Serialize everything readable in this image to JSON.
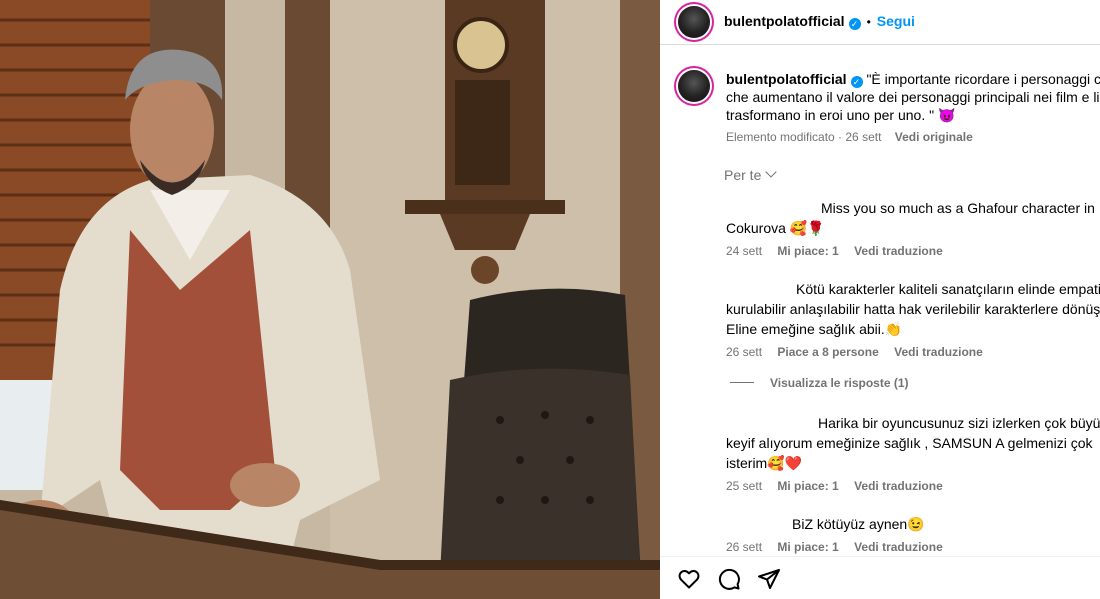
{
  "post": {
    "author": "bulentpolatofficial",
    "verified_icon": "verified-badge-icon",
    "follow_label": "Segui",
    "separator": "•"
  },
  "caption": {
    "author": "bulentpolatofficial",
    "text_line1": "\"È importante ricordare i personaggi ca",
    "text_line2": "che aumentano il valore dei personaggi principali nei film e li",
    "text_line3": "trasformano in eroi uno per uno. \" 😈",
    "edited": "Elemento modificato · 26 sett",
    "see_original": "Vedi originale"
  },
  "filter": {
    "label": "Per te",
    "icon": "chevron-down-icon"
  },
  "comments": [
    {
      "lines": [
        "Miss you so much as a Ghafour character in",
        "Cokurova 🥰🌹"
      ],
      "time": "24 sett",
      "likes": "Mi piace: 1",
      "translate": "Vedi traduzione"
    },
    {
      "lines": [
        "Kötü karakterler kaliteli sanatçıların elinde empati",
        "kurulabilir anlaşılabilir hatta hak verilebilir karakterlere dönüşü",
        "Eline emeğine sağlık abii.👏"
      ],
      "time": "26 sett",
      "likes": "Piace a 8 persone",
      "translate": "Vedi traduzione"
    },
    {
      "lines": [
        "Harika bir oyuncusunuz sizi izlerken çok büyük",
        "keyif alıyorum emeğinize sağlık , SAMSUN A gelmenizi çok",
        "isterim🥰❤️"
      ],
      "time": "25 sett",
      "likes": "Mi piace: 1",
      "translate": "Vedi traduzione"
    },
    {
      "lines": [
        "BiZ kötüyüz aynen😉"
      ],
      "time": "26 sett",
      "likes": "Mi piace: 1",
      "translate": "Vedi traduzione"
    }
  ],
  "view_replies": "Visualizza le risposte (1)",
  "actions": [
    "heart-icon",
    "comment-icon",
    "share-icon"
  ],
  "colors": {
    "accent": "#0095f6",
    "muted": "#737373",
    "divider": "#dbdbdb"
  }
}
